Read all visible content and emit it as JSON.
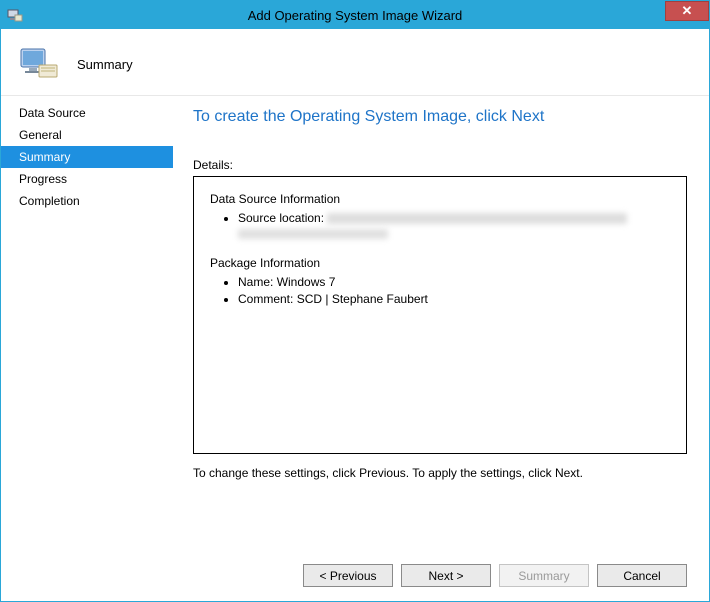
{
  "window": {
    "title": "Add Operating System Image Wizard"
  },
  "header": {
    "title": "Summary"
  },
  "sidebar": {
    "items": [
      {
        "label": "Data Source",
        "selected": false
      },
      {
        "label": "General",
        "selected": false
      },
      {
        "label": "Summary",
        "selected": true
      },
      {
        "label": "Progress",
        "selected": false
      },
      {
        "label": "Completion",
        "selected": false
      }
    ]
  },
  "main": {
    "heading": "To create the Operating System Image, click Next",
    "details_label": "Details:",
    "data_source_section": "Data Source Information",
    "source_location_label": "Source location:",
    "package_section": "Package Information",
    "package_name_label": "Name:",
    "package_name_value": "Windows 7",
    "package_comment_label": "Comment:",
    "package_comment_value": "SCD | Stephane Faubert",
    "hint": "To change these settings, click Previous. To apply the settings, click Next."
  },
  "buttons": {
    "previous": "< Previous",
    "next": "Next >",
    "summary": "Summary",
    "cancel": "Cancel"
  }
}
